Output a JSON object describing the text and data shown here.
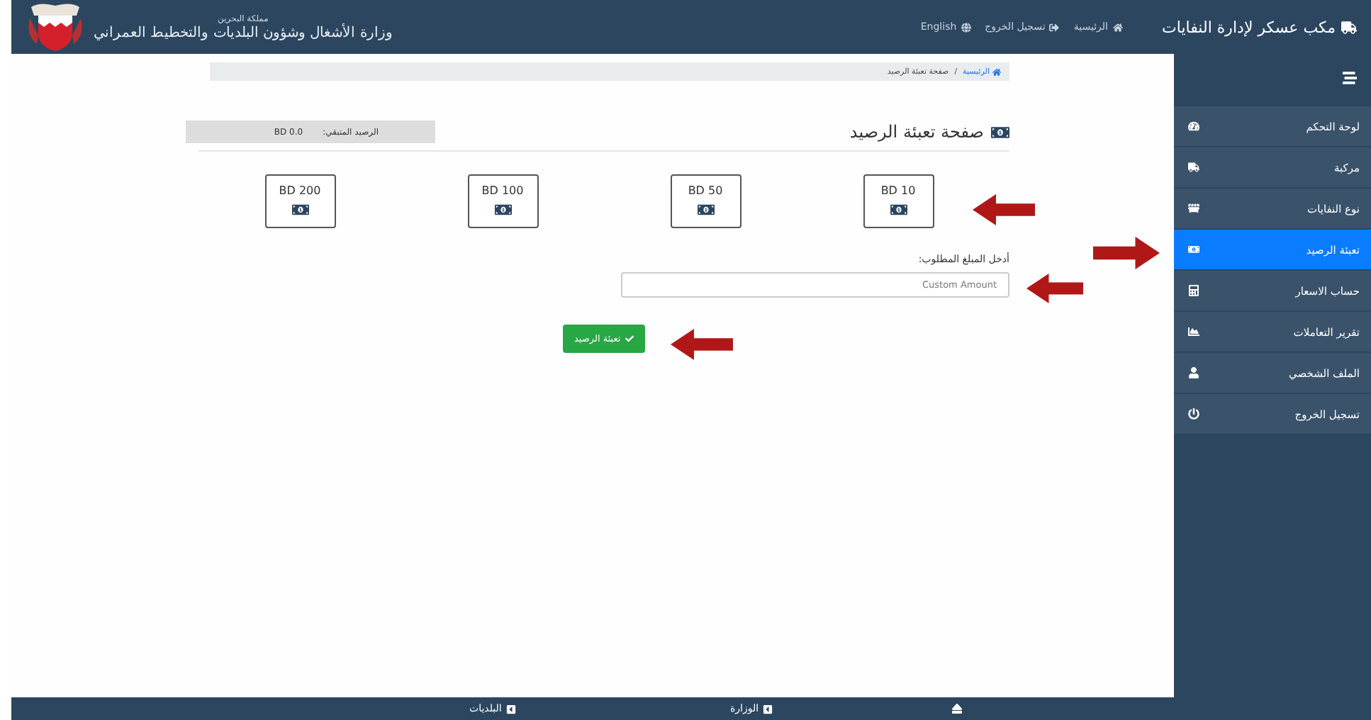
{
  "header": {
    "brand": "مكب عسكر لإدارة النفايات",
    "nav": [
      {
        "label": "الرئيسية"
      },
      {
        "label": "تسجيل الخروج"
      },
      {
        "label": "English"
      }
    ],
    "ministry": {
      "country": "مملكة البحرين",
      "name": "وزارة الأشغال وشؤون البلديات والتخطيط العمراني"
    }
  },
  "breadcrumb": {
    "items": [
      "الرئيسية",
      "صفحة تعبئة الرصيد"
    ],
    "separator": "/"
  },
  "page_title": "صفحة تعبئة الرصيد",
  "balance": {
    "label": "الرصيد المتبقي:",
    "value": "BD 0.0"
  },
  "amounts": [
    "BD 10",
    "BD 50",
    "BD 100",
    "BD 200"
  ],
  "custom": {
    "label": "أدخل المبلغ المطلوب:",
    "placeholder": "Custom Amount"
  },
  "submit": "تعبئة الرصيد",
  "sidebar": {
    "items": [
      {
        "label": "لوحة التحكم",
        "selected": false
      },
      {
        "label": "مركبة",
        "selected": false
      },
      {
        "label": "نوع النفايات",
        "selected": false
      },
      {
        "label": "تعبئة الرصيد",
        "selected": true
      },
      {
        "label": "حساب الاسعار",
        "selected": false
      },
      {
        "label": "تقرير التعاملات",
        "selected": false
      },
      {
        "label": "الملف الشخصي",
        "selected": false
      },
      {
        "label": "تسجيل الخروج",
        "selected": false
      }
    ]
  },
  "footer": {
    "links": [
      "الوزارة",
      "البلديات"
    ]
  }
}
